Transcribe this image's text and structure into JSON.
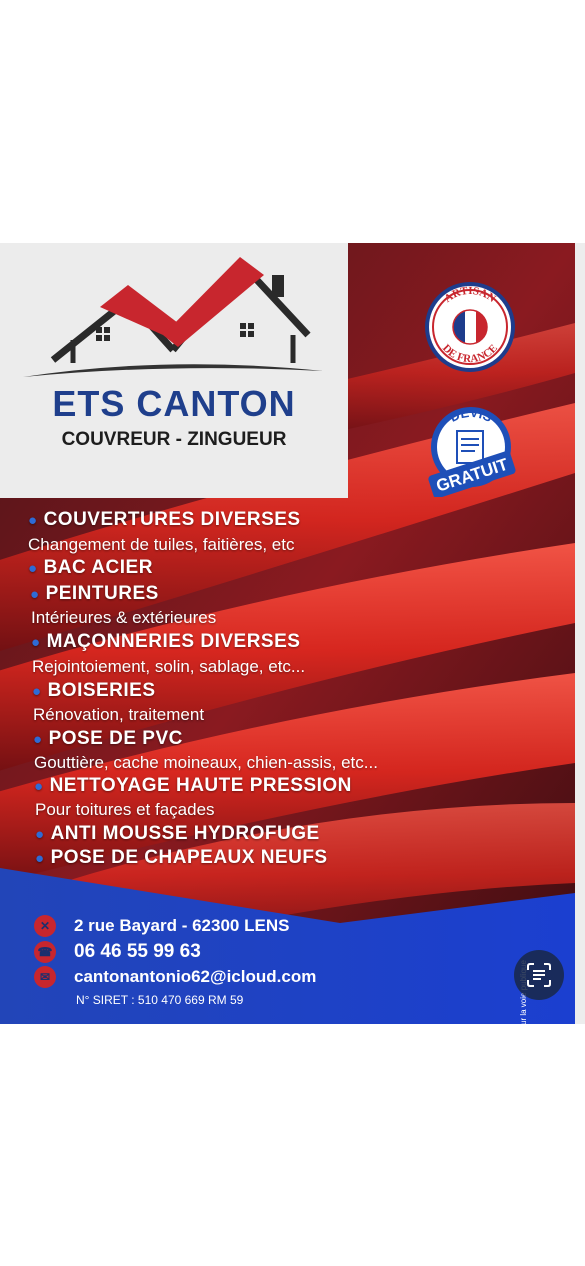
{
  "company": {
    "name": "ETS CANTON",
    "subtitle": "COUVREUR - ZINGUEUR"
  },
  "badges": {
    "artisan_top": "ARTISAN",
    "artisan_bottom": "DE FRANCE",
    "devis_top": "DEVIS",
    "devis_bottom": "GRATUIT"
  },
  "services": [
    {
      "title": "COUVERTURES DIVERSES",
      "desc": "Changement de tuiles, faitières, etc"
    },
    {
      "title": "BAC ACIER",
      "desc": ""
    },
    {
      "title": "PEINTURES",
      "desc": "Intérieures & extérieures"
    },
    {
      "title": "MAÇONNERIES DIVERSES",
      "desc": "Rejointoiement, solin, sablage, etc..."
    },
    {
      "title": "BOISERIES",
      "desc": "Rénovation, traitement"
    },
    {
      "title": "POSE DE PVC",
      "desc": "Gouttière, cache moineaux, chien-assis, etc..."
    },
    {
      "title": "NETTOYAGE HAUTE PRESSION",
      "desc": "Pour toitures et façades"
    },
    {
      "title": "ANTI MOUSSE HYDROFUGE",
      "desc": ""
    },
    {
      "title": "POSE DE CHAPEAUX NEUFS",
      "desc": ""
    }
  ],
  "contact": {
    "address": "2 rue Bayard - 62300 LENS",
    "phone": "06 46 55 99 63",
    "email": "cantonantonio62@icloud.com",
    "siret": "N° SIRET : 510 470 669 RM 59"
  },
  "legal_note": "ne pas jeter sur la voie publique",
  "icons": {
    "address": "location-pin-icon",
    "phone": "phone-icon",
    "email": "envelope-icon",
    "scan": "text-scan-icon"
  },
  "colors": {
    "brand_blue": "#1f3f8c",
    "roof_red": "#c8262e",
    "footer_blue": "#1e4ed8"
  }
}
